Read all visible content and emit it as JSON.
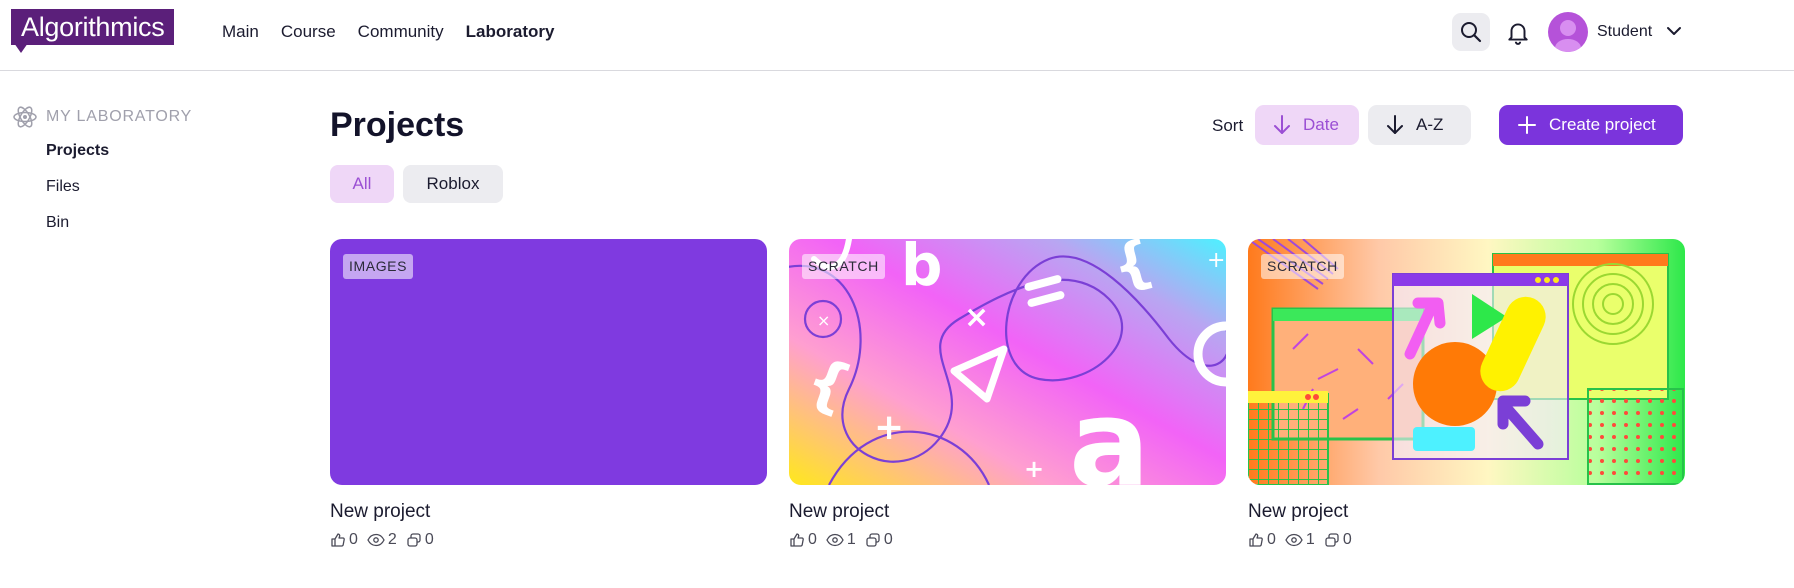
{
  "header": {
    "logo": "Algorithmics",
    "nav": [
      "Main",
      "Course",
      "Community",
      "Laboratory"
    ],
    "active_nav": "Laboratory",
    "user_name": "Student",
    "icons": [
      "search-icon",
      "bell-icon",
      "chevron-down-icon"
    ]
  },
  "sidebar": {
    "heading": "MY LABORATORY",
    "heading_icon": "atom-icon",
    "items": [
      "Projects",
      "Files",
      "Bin"
    ],
    "active_item": "Projects"
  },
  "main": {
    "title": "Projects",
    "sort_label": "Sort",
    "sort_options": [
      "Date",
      "A-Z"
    ],
    "active_sort": "Date",
    "create_label": "Create project",
    "filters": [
      "All",
      "Roblox"
    ],
    "active_filter": "All",
    "projects": [
      {
        "tag": "IMAGES",
        "title": "New project",
        "likes": "0",
        "views": "2",
        "copies": "0",
        "thumb_color": "#7f3ae0"
      },
      {
        "tag": "SCRATCH",
        "title": "New project",
        "likes": "0",
        "views": "1",
        "copies": "0"
      },
      {
        "tag": "SCRATCH",
        "title": "New project",
        "likes": "0",
        "views": "1",
        "copies": "0"
      }
    ]
  },
  "colors": {
    "brand": "#5b1f7a",
    "accent": "#7b34dc",
    "accent_soft": "#efd7f7",
    "accent_text": "#9b4fd4",
    "neutral_chip": "#ececf0"
  }
}
